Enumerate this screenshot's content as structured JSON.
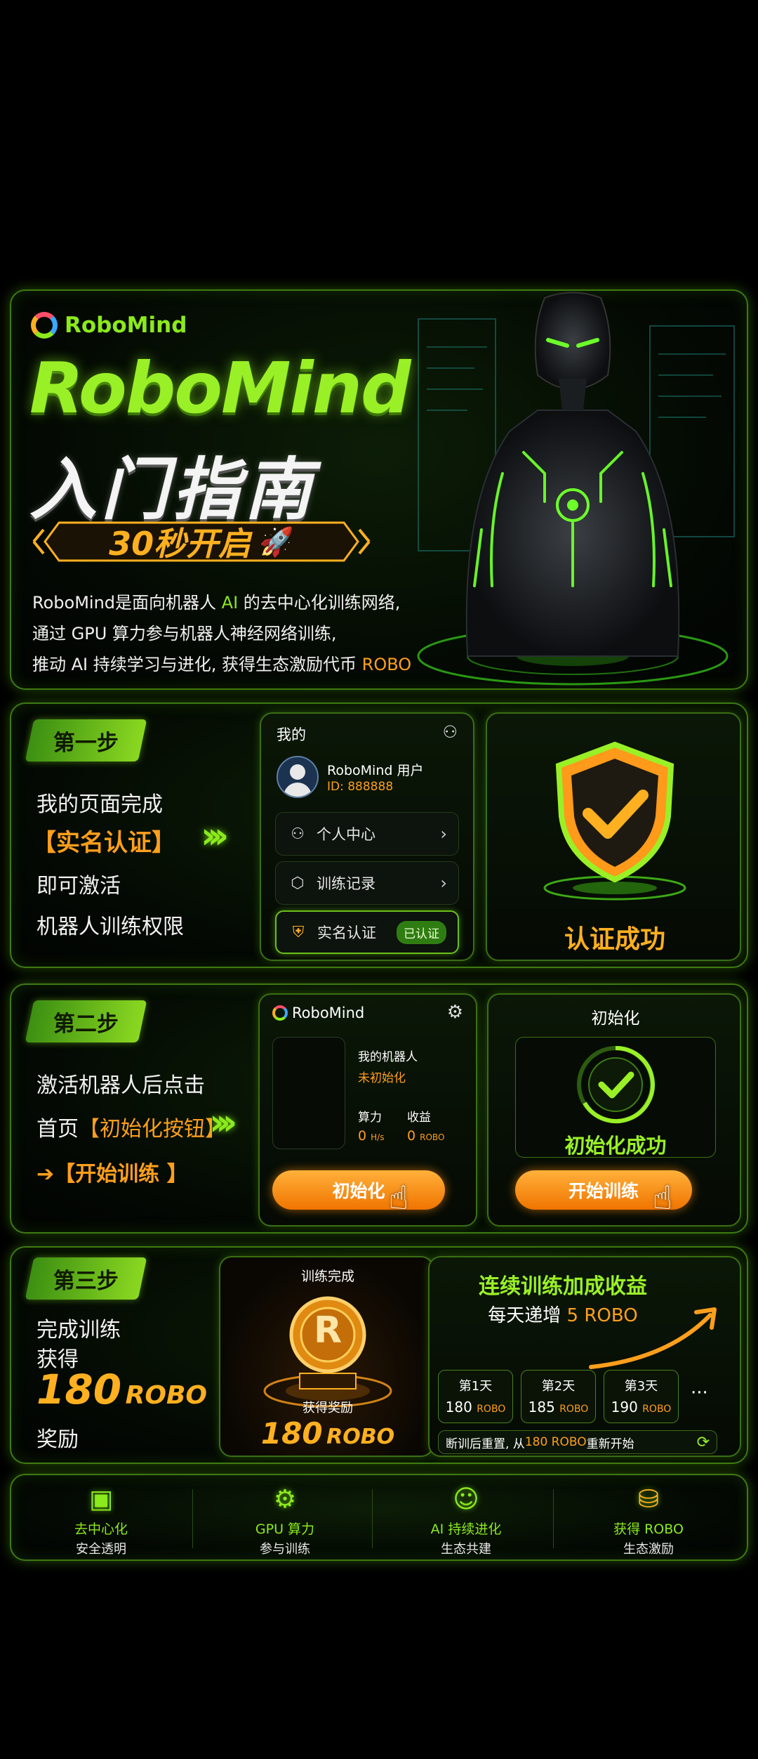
{
  "hero": {
    "logo_text": "RoboMind",
    "title_en": "RoboMind",
    "title_cn": "入门指南",
    "badge": "30秒开启",
    "desc_line1_a": "RoboMind是面向机器人 ",
    "desc_line1_ai": "AI",
    "desc_line1_b": " 的去中心化训练网络,",
    "desc_line2": "通过 GPU 算力参与机器人神经网络训练,",
    "desc_line3_a": "推动 AI 持续学习与进化, 获得生态激励代币 ",
    "desc_line3_robo": "ROBO"
  },
  "step1": {
    "tag": "第一步",
    "line1": "我的页面完成",
    "line2": "【实名认证】",
    "line3": "即可激活",
    "line4": "机器人训练权限",
    "phone": {
      "title": "我的",
      "username": "RoboMind 用户",
      "user_id": "ID: 888888",
      "menu_personal": "个人中心",
      "menu_records": "训练记录",
      "menu_verify": "实名认证",
      "verified_badge": "已认证"
    },
    "result": "认证成功"
  },
  "step2": {
    "tag": "第二步",
    "line1": "激活机器人后点击",
    "line2_a": "首页",
    "line2_b": "【初始化按钮】",
    "line3_arrow": "➔",
    "line3": "【开始训练 】",
    "app": {
      "brand": "RoboMind",
      "my_robot": "我的机器人",
      "status": "未初始化",
      "power_label": "算力",
      "earn_label": "收益",
      "power_value": "0",
      "power_unit": "H/s",
      "earn_value": "0",
      "earn_unit": "ROBO",
      "init_button": "初始化"
    },
    "init": {
      "title": "初始化",
      "success": "初始化成功",
      "start_button": "开始训练"
    }
  },
  "step3": {
    "tag": "第三步",
    "line1": "完成训练",
    "line2": "获得",
    "amount": "180",
    "amount_unit": "ROBO",
    "line4": "奖励",
    "reward": {
      "done": "训练完成",
      "coin_letter": "R",
      "label": "获得奖励",
      "amount": "180",
      "unit": "ROBO"
    },
    "bonus": {
      "title": "连续训练加成收益",
      "sub_a": "每天递增 ",
      "sub_b": "5 ROBO",
      "days": [
        {
          "day": "第1天",
          "value": "180",
          "unit": "ROBO"
        },
        {
          "day": "第2天",
          "value": "185",
          "unit": "ROBO"
        },
        {
          "day": "第3天",
          "value": "190",
          "unit": "ROBO"
        }
      ],
      "more": "···",
      "reset_a": "断训后重置, 从 ",
      "reset_b": "180 ROBO",
      "reset_c": " 重新开始"
    }
  },
  "features": [
    {
      "title": "去中心化",
      "sub": "安全透明",
      "icon": "chip-r-icon"
    },
    {
      "title": "GPU 算力",
      "sub": "参与训练",
      "icon": "gpu-fan-icon"
    },
    {
      "title": "AI 持续进化",
      "sub": "生态共建",
      "icon": "robot-head-icon"
    },
    {
      "title": "获得 ROBO",
      "sub": "生态激励",
      "icon": "coin-stack-icon"
    }
  ],
  "colors": {
    "accent": "#8bea1c",
    "orange": "#ff9f1c",
    "bg": "#000000"
  }
}
